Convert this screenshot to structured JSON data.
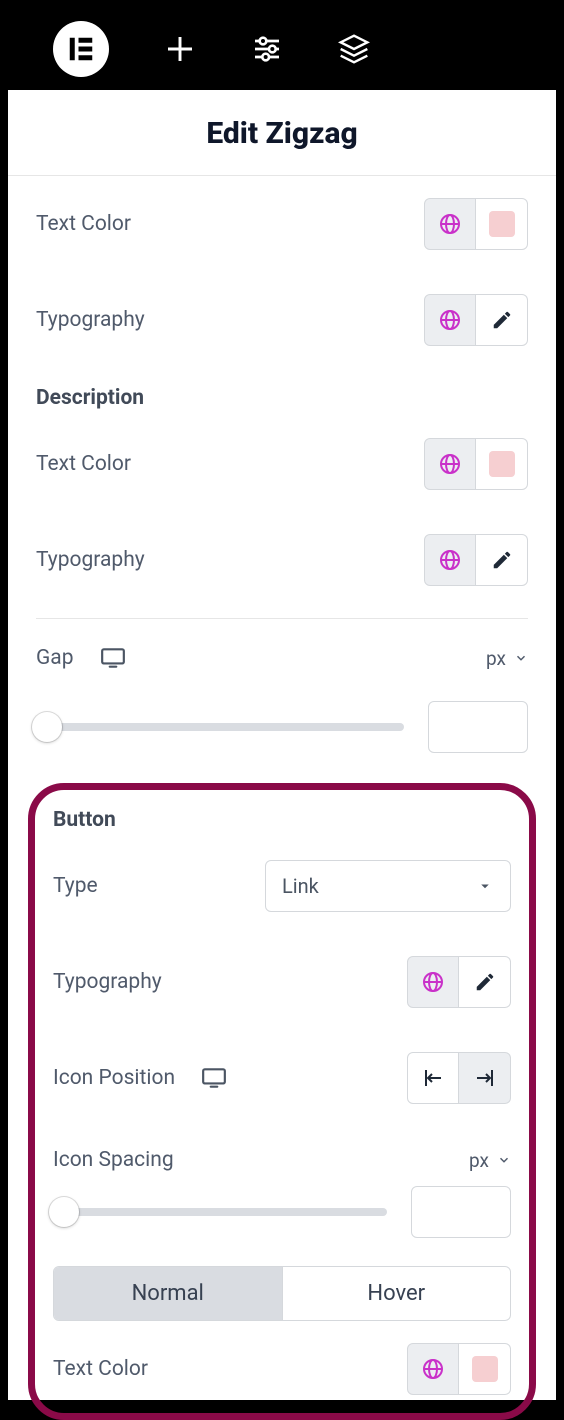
{
  "header": {
    "title": "Edit Zigzag"
  },
  "controls": {
    "text_color_1": "Text Color",
    "typography_1": "Typography",
    "description_h": "Description",
    "text_color_2": "Text Color",
    "typography_2": "Typography",
    "gap": "Gap",
    "gap_unit": "px"
  },
  "button_section": {
    "heading": "Button",
    "type_label": "Type",
    "type_value": "Link",
    "typography": "Typography",
    "icon_position": "Icon Position",
    "icon_spacing": "Icon Spacing",
    "icon_spacing_unit": "px",
    "state_normal": "Normal",
    "state_hover": "Hover",
    "text_color": "Text Color"
  }
}
